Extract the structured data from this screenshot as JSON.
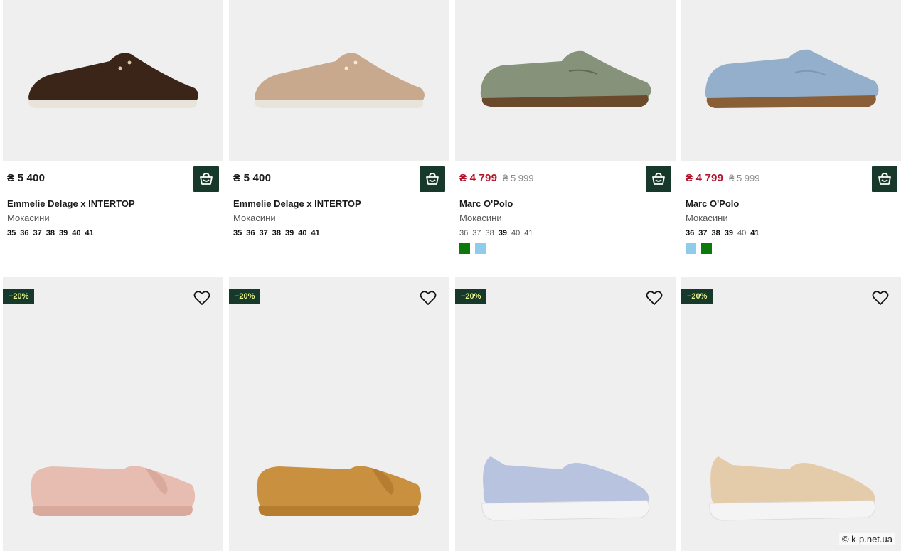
{
  "colors": {
    "accent": "#17392b",
    "sale": "#b3122b",
    "badge_text": "#e8f48c",
    "card_bg": "#efefef"
  },
  "products_top": [
    {
      "price": "₴ 5 400",
      "old_price": "",
      "brand": "Emmelie Delage x INTERTOP",
      "category": "Мокасини",
      "sizes": [
        "35",
        "36",
        "37",
        "38",
        "39",
        "40",
        "41"
      ],
      "swatches": [],
      "shoe_color": "#3b2418",
      "icon": "shopping-bag-icon"
    },
    {
      "price": "₴ 5 400",
      "old_price": "",
      "brand": "Emmelie Delage x INTERTOP",
      "category": "Мокасини",
      "sizes": [
        "35",
        "36",
        "37",
        "38",
        "39",
        "40",
        "41"
      ],
      "swatches": [],
      "shoe_color": "#c9a98e",
      "icon": "shopping-bag-icon"
    },
    {
      "price": "₴ 4 799",
      "old_price": "₴ 5 999",
      "brand": "Marc O'Polo",
      "category": "Мокасини",
      "sizes": [
        "36",
        "37",
        "38",
        "39",
        "40",
        "41"
      ],
      "swatches": [
        "#0b7a0b",
        "#8fcbea"
      ],
      "shoe_color": "#86927a",
      "icon": "shopping-bag-icon"
    },
    {
      "price": "₴ 4 799",
      "old_price": "₴ 5 999",
      "brand": "Marc O'Polo",
      "category": "Мокасини",
      "sizes": [
        "36",
        "37",
        "38",
        "39",
        "40",
        "41"
      ],
      "swatches": [
        "#8fcbea",
        "#0b7a0b"
      ],
      "shoe_color": "#93afcb",
      "icon": "shopping-bag-icon"
    }
  ],
  "products_bottom": [
    {
      "badge": "−20%",
      "shoe_color": "#e6bdb0",
      "icon": "heart-icon"
    },
    {
      "badge": "−20%",
      "shoe_color": "#c99040",
      "icon": "heart-icon"
    },
    {
      "badge": "−20%",
      "shoe_color": "#b7c3df",
      "icon": "heart-icon"
    },
    {
      "badge": "−20%",
      "shoe_color": "#e4ccab",
      "icon": "heart-icon"
    }
  ],
  "watermark": "© k-p.net.ua"
}
